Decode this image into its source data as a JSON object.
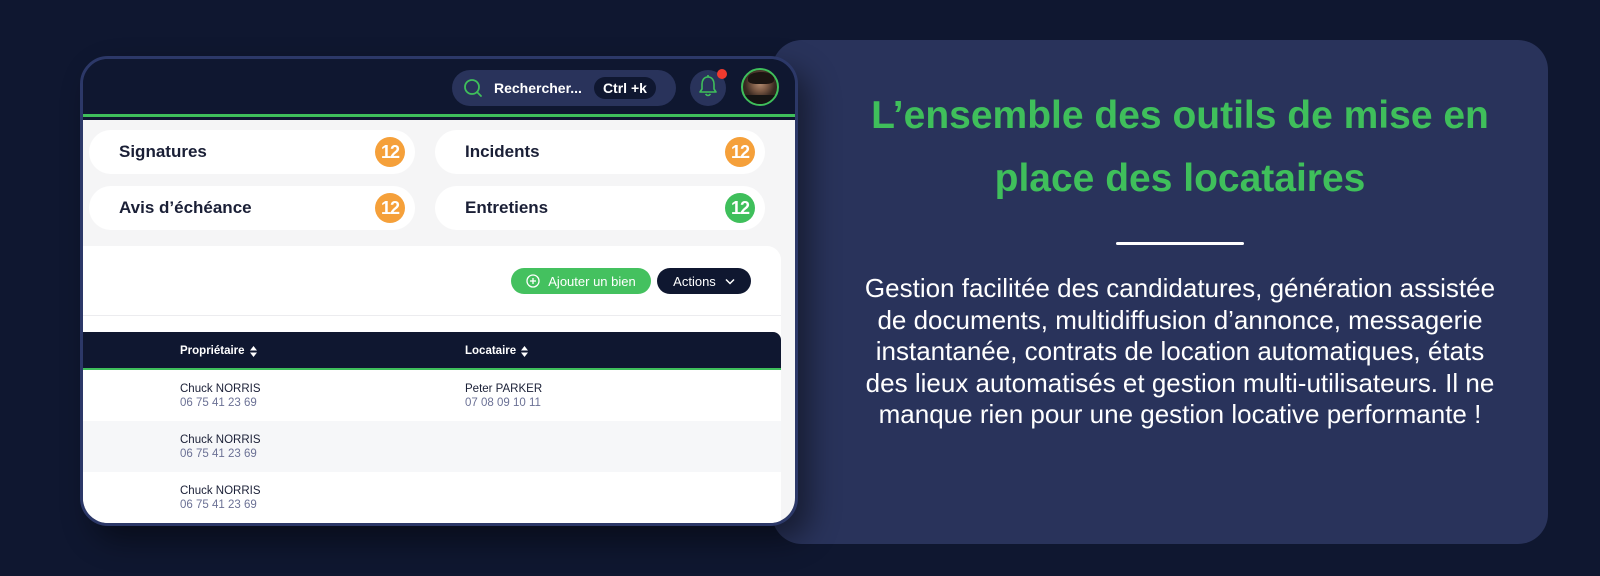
{
  "app": {
    "search": {
      "placeholder": "Rechercher...",
      "shortcut": "Ctrl +k",
      "icon": "search-icon"
    },
    "notifications": {
      "icon": "bell-icon",
      "has_unread": true
    },
    "avatar": {
      "icon": "user-avatar"
    },
    "stats": [
      {
        "label": "Signatures",
        "count": "12",
        "color": "#f5a03a"
      },
      {
        "label": "Incidents",
        "count": "12",
        "color": "#f5a03a"
      },
      {
        "label": "Avis d’échéance",
        "count": "12",
        "color": "#f5a03a"
      },
      {
        "label": "Entretiens",
        "count": "12",
        "color": "#3fbf5b"
      }
    ],
    "toolbar": {
      "add_label": "Ajouter un bien",
      "add_icon": "plus-circle-icon",
      "actions_label": "Actions",
      "actions_icon": "chevron-down-icon"
    },
    "table": {
      "columns": [
        {
          "label": "Propriétaire",
          "sortable": true
        },
        {
          "label": "Locataire",
          "sortable": true
        }
      ],
      "rows": [
        {
          "owner_name": "Chuck NORRIS",
          "owner_phone": "06 75 41 23 69",
          "tenant_name": "Peter PARKER",
          "tenant_phone": "07 08 09 10 11"
        },
        {
          "owner_name": "Chuck NORRIS",
          "owner_phone": "06 75 41 23 69",
          "tenant_name": "",
          "tenant_phone": ""
        },
        {
          "owner_name": "Chuck NORRIS",
          "owner_phone": "06 75 41 23 69",
          "tenant_name": "",
          "tenant_phone": ""
        }
      ]
    }
  },
  "info": {
    "title": "L’ensemble des outils de mise en place des locataires",
    "body": "Gestion facilitée des candidatures, génération assistée de documents, multidiffusion d’annonce, messagerie instantanée, contrats de location automatiques, états des lieux automatisés et gestion multi-utilisateurs. Il ne manque rien pour une gestion locative performante !"
  },
  "colors": {
    "background": "#0f1730",
    "panel": "#29335b",
    "accent_green": "#3fbf5b",
    "badge_orange": "#f5a03a",
    "notification_red": "#f03a2e"
  }
}
